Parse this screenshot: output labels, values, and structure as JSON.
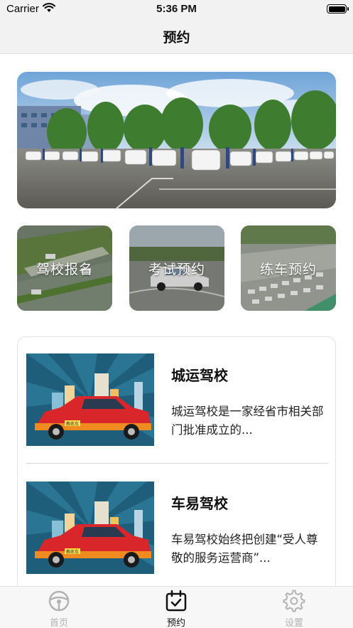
{
  "status_bar": {
    "carrier": "Carrier",
    "time": "5:36 PM",
    "battery_level": 1.0
  },
  "nav": {
    "title": "预约"
  },
  "banner": {
    "image": "driving-school-fleet-photo"
  },
  "quick_entries": [
    {
      "label": "驾校报名",
      "icon": "training-ground-photo"
    },
    {
      "label": "考试预约",
      "icon": "exam-car-photo"
    },
    {
      "label": "练车预约",
      "icon": "parking-lot-photo"
    }
  ],
  "schools": [
    {
      "name": "城运驾校",
      "desc": "城运驾校是一家经省市相关部门批准成立的...",
      "car_sign": "教练车"
    },
    {
      "name": "车易驾校",
      "desc": "车易驾校始终把创建“受人尊敬的服务运营商”...",
      "car_sign": "教练车"
    }
  ],
  "tab_bar": {
    "items": [
      {
        "label": "首页",
        "icon": "steering-wheel-icon",
        "active": false
      },
      {
        "label": "预约",
        "icon": "calendar-check-icon",
        "active": true
      },
      {
        "label": "设置",
        "icon": "gear-icon",
        "active": false
      }
    ]
  },
  "colors": {
    "accent_active": "#111111",
    "inactive": "#b3b3b3",
    "car_red": "#d9262b",
    "thumb_bg": "#1f5e7a"
  }
}
